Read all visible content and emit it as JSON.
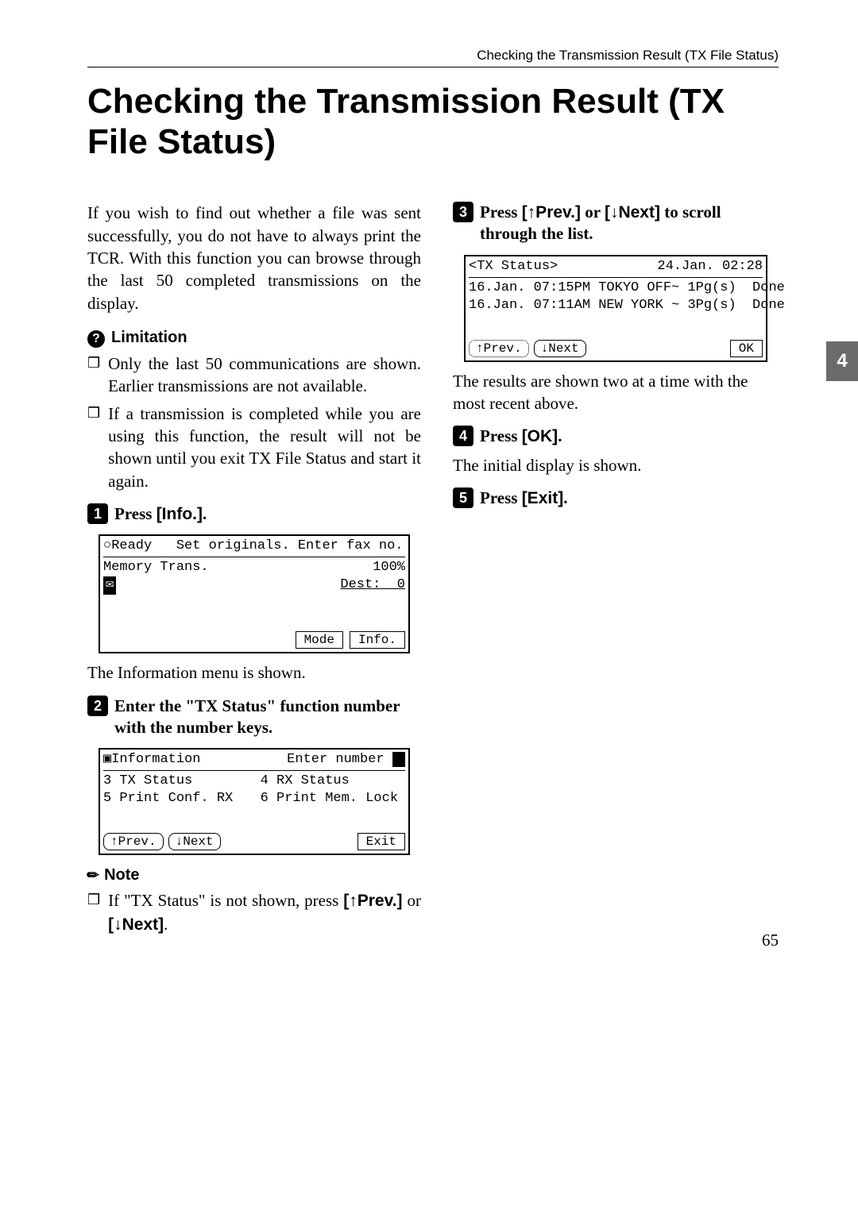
{
  "running_head": "Checking the Transmission Result (TX File Status)",
  "title": "Checking the Transmission Result (TX File Status)",
  "intro": "If you wish to find out whether a file was sent successfully, you do not have to always print the TCR. With this function you can browse through the last 50 completed transmissions on the display.",
  "limitation": {
    "heading": "Limitation",
    "items": [
      "Only the last 50 communications are shown. Earlier transmissions are not available.",
      "If a transmission is completed while you are using this function, the result will not be shown until you exit TX File Status and start it again."
    ]
  },
  "step1": {
    "num": "1",
    "text_before": "Press ",
    "button": "[Info.]",
    "text_after": ".",
    "after": "The Information menu is shown."
  },
  "lcd1": {
    "line1_left": "○Ready",
    "line1_right": "Set originals. Enter fax no.",
    "line2_left": "Memory Trans.",
    "line2_right": "100%",
    "line3_dest": "Dest:  0",
    "btn_mode": "Mode",
    "btn_info": "Info."
  },
  "step2": {
    "num": "2",
    "text": "Enter the \"TX Status\" function number with the number keys."
  },
  "lcd2": {
    "title_left": "▣Information",
    "title_right": "Enter number",
    "row1_left": "3 TX Status",
    "row1_right": "4 RX Status",
    "row2_left": "5 Print Conf. RX",
    "row2_right": "6 Print Mem. Lock",
    "btn_prev": "↑Prev.",
    "btn_next": "↓Next",
    "btn_exit": "Exit"
  },
  "note": {
    "heading": "Note",
    "text_before": "If \"TX Status\" is not shown, press ",
    "prev": "[↑Prev.]",
    "or": " or ",
    "next": "[↓Next]",
    "text_after": "."
  },
  "step3": {
    "num": "3",
    "t1": "Press ",
    "prev": "[↑Prev.]",
    "t2": " or ",
    "next": "[↓Next]",
    "t3": " to scroll through the list."
  },
  "lcd3": {
    "title_left": "<TX Status>",
    "title_right": "24.Jan. 02:28",
    "row1": "16.Jan. 07:15PM TOKYO OFF~ 1Pg(s)  Done",
    "row2": "16.Jan. 07:11AM NEW YORK ~ 3Pg(s)  Done",
    "btn_prev": "↑Prev.",
    "btn_next": "↓Next",
    "btn_ok": "OK"
  },
  "step3_after": "The results are shown two at a time with the most recent above.",
  "step4": {
    "num": "4",
    "t1": "Press ",
    "btn": "[OK]",
    "t2": ".",
    "after": "The initial display is shown."
  },
  "step5": {
    "num": "5",
    "t1": "Press ",
    "btn": "[Exit]",
    "t2": "."
  },
  "side_tab": "4",
  "page_number": "65"
}
